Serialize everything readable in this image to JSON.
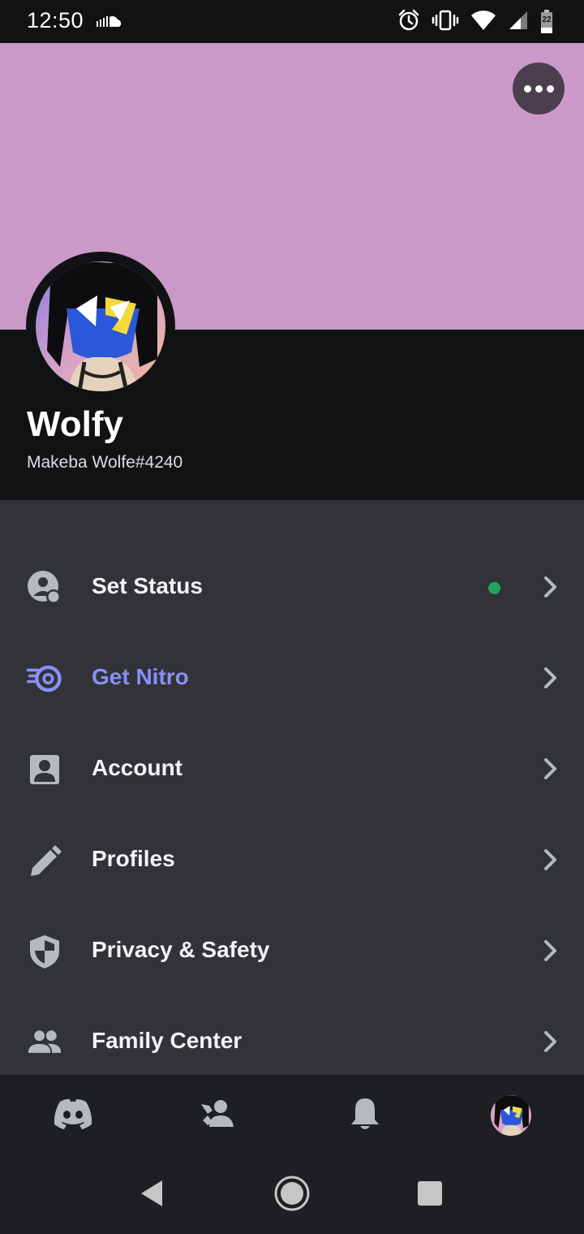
{
  "status_bar": {
    "time": "12:50",
    "battery_level": "22",
    "icons": [
      "soundcloud-icon",
      "alarm-icon",
      "vibrate-icon",
      "wifi-icon",
      "cellular-signal-icon",
      "battery-icon"
    ]
  },
  "profile": {
    "banner_color": "#cb99c9",
    "display_name": "Wolfy",
    "username": "Makeba Wolfe#4240",
    "online_status_color": "#23a55a"
  },
  "menu": {
    "items": [
      {
        "label": "Set Status",
        "icon": "status-icon"
      },
      {
        "label": "Get Nitro",
        "icon": "nitro-icon",
        "color": "#8a8ef7"
      },
      {
        "label": "Account",
        "icon": "account-icon"
      },
      {
        "label": "Profiles",
        "icon": "pencil-icon"
      },
      {
        "label": "Privacy & Safety",
        "icon": "shield-icon"
      },
      {
        "label": "Family Center",
        "icon": "family-icon"
      }
    ]
  },
  "tabs": [
    {
      "name": "home",
      "icon": "discord-icon"
    },
    {
      "name": "friends",
      "icon": "friends-icon"
    },
    {
      "name": "notifications",
      "icon": "bell-icon"
    },
    {
      "name": "you",
      "icon": "avatar",
      "active": true
    }
  ],
  "nav": [
    "back-icon",
    "home-icon",
    "recents-icon"
  ]
}
